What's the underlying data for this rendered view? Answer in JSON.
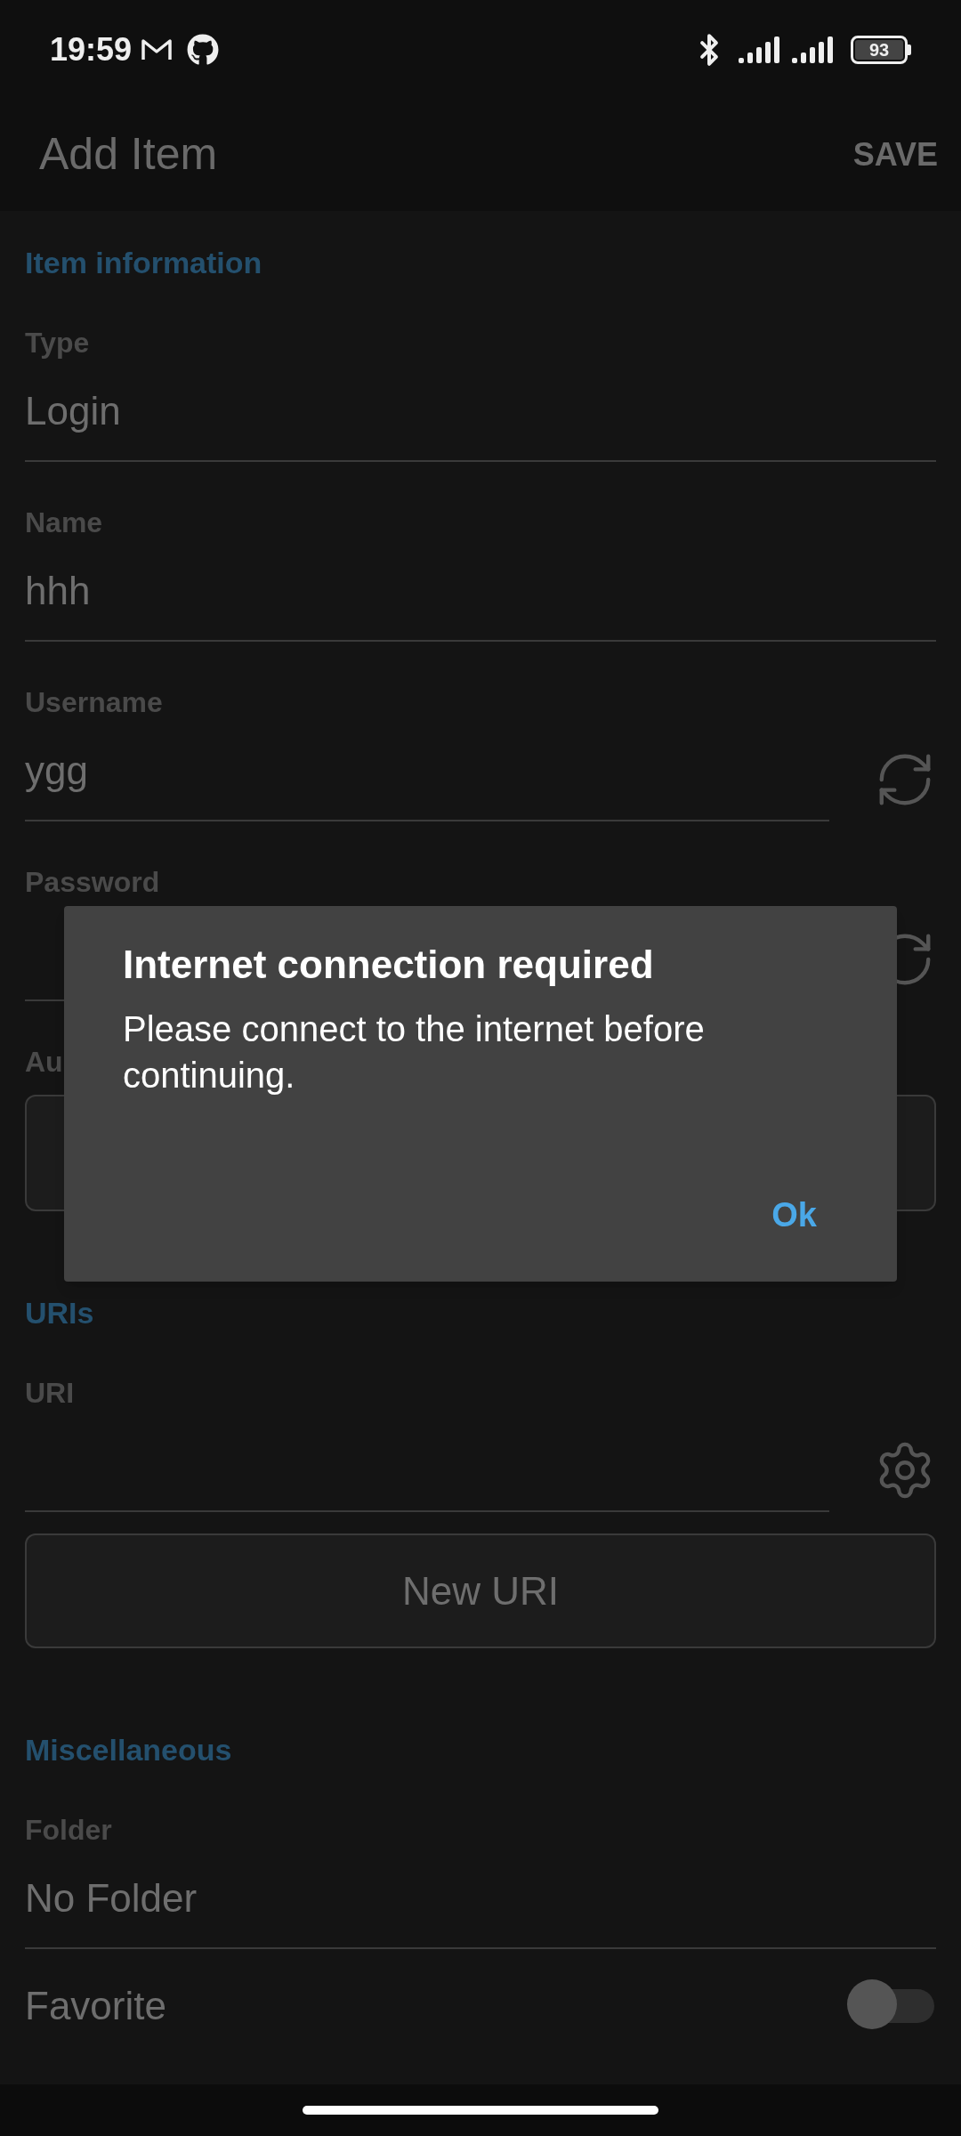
{
  "status_bar": {
    "time": "19:59",
    "battery": "93"
  },
  "app_bar": {
    "title": "Add Item",
    "action": "SAVE"
  },
  "sections": [
    {
      "title": "Item information",
      "fields": [
        {
          "kind": "text",
          "label": "Type",
          "value": "Login"
        },
        {
          "kind": "text",
          "label": "Name",
          "value": "hhh"
        },
        {
          "kind": "generate",
          "label": "Username",
          "value": "ygg"
        },
        {
          "kind": "generate",
          "label": "Password"
        },
        {
          "kind": "outlined",
          "label": "Au"
        }
      ]
    },
    {
      "title": "URIs",
      "fields": [
        {
          "kind": "settings",
          "label": "URI"
        },
        {
          "kind": "button",
          "value": "New URI"
        }
      ]
    },
    {
      "title": "Miscellaneous",
      "fields": [
        {
          "kind": "text",
          "label": "Folder",
          "value": "No Folder"
        },
        {
          "kind": "toggle",
          "label": "Favorite",
          "on": false
        }
      ]
    }
  ],
  "dialog": {
    "title": "Internet connection required",
    "message": "Please connect to the internet before continuing.",
    "button": "Ok"
  }
}
